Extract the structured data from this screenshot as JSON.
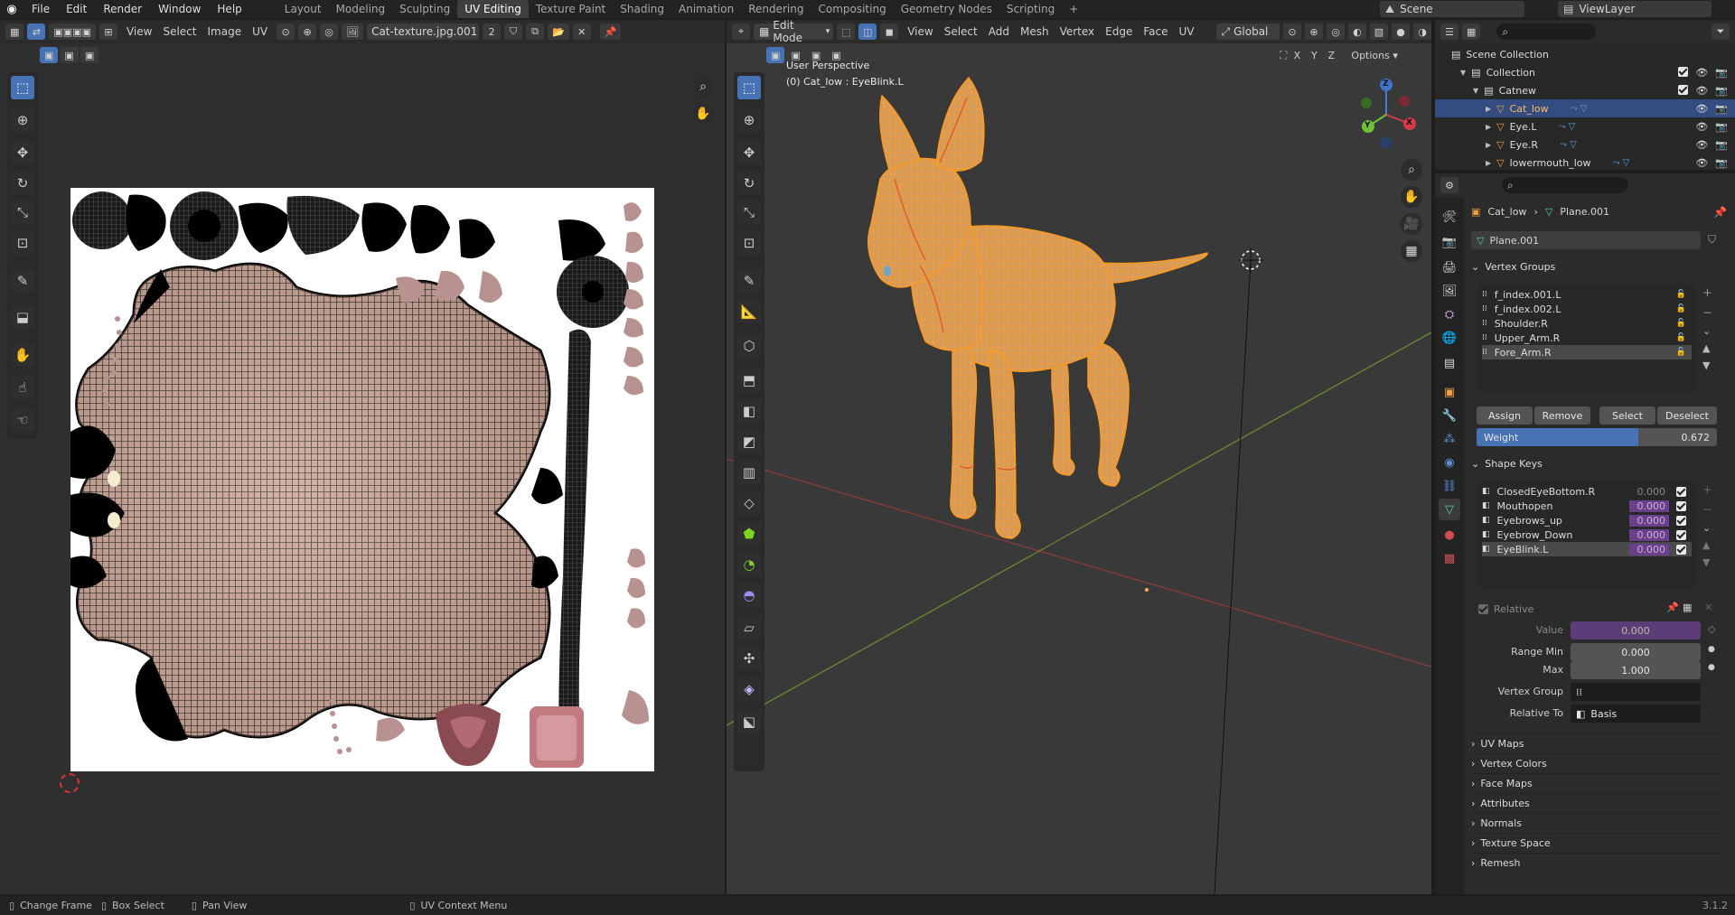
{
  "topbar": {
    "menus": [
      "File",
      "Edit",
      "Render",
      "Window",
      "Help"
    ],
    "workspaces": [
      "Layout",
      "Modeling",
      "Sculpting",
      "UV Editing",
      "Texture Paint",
      "Shading",
      "Animation",
      "Rendering",
      "Compositing",
      "Geometry Nodes",
      "Scripting"
    ],
    "active_workspace": "UV Editing",
    "add_tab": "+",
    "scene": "Scene",
    "view_layer": "ViewLayer"
  },
  "uv_editor": {
    "menus": [
      "View",
      "Select",
      "Image",
      "UV"
    ],
    "image_name": "Cat-texture.jpg.001",
    "users": "2"
  },
  "viewport": {
    "mode": "Edit Mode",
    "menus": [
      "View",
      "Select",
      "Add",
      "Mesh",
      "Vertex",
      "Edge",
      "Face",
      "UV"
    ],
    "orientation": "Global",
    "xyz": [
      "X",
      "Y",
      "Z"
    ],
    "options": "Options",
    "perspective": "User Perspective",
    "object_info": "(0) Cat_low : EyeBlink.L",
    "gizmo": {
      "x": "X",
      "y": "Y",
      "z": "Z"
    }
  },
  "outliner": {
    "scene_collection": "Scene Collection",
    "items": [
      {
        "name": "Collection",
        "indent": 1
      },
      {
        "name": "Catnew",
        "indent": 2
      },
      {
        "name": "Cat_low",
        "indent": 3,
        "selected": true
      },
      {
        "name": "Eye.L",
        "indent": 3
      },
      {
        "name": "Eye.R",
        "indent": 3
      },
      {
        "name": "lowermouth_low",
        "indent": 3
      }
    ]
  },
  "properties": {
    "breadcrumb_object": "Cat_low",
    "breadcrumb_mesh": "Plane.001",
    "mesh_name": "Plane.001",
    "vertex_groups": {
      "title": "Vertex Groups",
      "items": [
        "f_index.001.L",
        "f_index.002.L",
        "Shoulder.R",
        "Upper_Arm.R",
        "Fore_Arm.R"
      ],
      "active": "Fore_Arm.R",
      "assign": "Assign",
      "remove": "Remove",
      "select": "Select",
      "deselect": "Deselect",
      "weight_label": "Weight",
      "weight_value": "0.672",
      "weight_fraction": 0.672
    },
    "shape_keys": {
      "title": "Shape Keys",
      "items": [
        {
          "name": "ClosedEyeBottom.R",
          "value": "0.000"
        },
        {
          "name": "Mouthopen",
          "value": "0.000"
        },
        {
          "name": "Eyebrows_up",
          "value": "0.000"
        },
        {
          "name": "Eyebrow_Down",
          "value": "0.000"
        },
        {
          "name": "EyeBlink.L",
          "value": "0.000"
        }
      ],
      "active": "EyeBlink.L",
      "relative_label": "Relative",
      "value_label": "Value",
      "value": "0.000",
      "range_min_label": "Range Min",
      "range_min": "0.000",
      "max_label": "Max",
      "max": "1.000",
      "vertex_group_label": "Vertex Group",
      "relative_to_label": "Relative To",
      "relative_to": "Basis"
    },
    "collapsed_panels": [
      "UV Maps",
      "Vertex Colors",
      "Face Maps",
      "Attributes",
      "Normals",
      "Texture Space",
      "Remesh"
    ]
  },
  "statusbar": {
    "items": [
      "Change Frame",
      "Box Select",
      "Pan View",
      "UV Context Menu"
    ],
    "version": "3.1.2"
  },
  "colors": {
    "accent": "#4772b3",
    "mesh": "#f7a33a",
    "purple": "#6a3f8c",
    "active_row": "#334d80"
  }
}
